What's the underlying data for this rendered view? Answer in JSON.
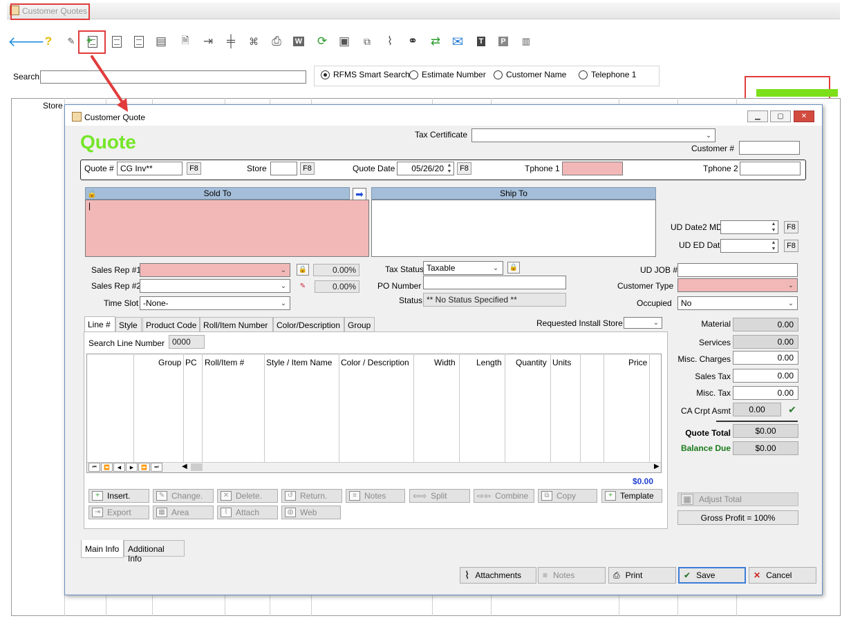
{
  "outer": {
    "title": "Customer Quotes",
    "search_label": "Search",
    "search_value": "",
    "search_options": [
      {
        "label": "RFMS Smart Search",
        "selected": true
      },
      {
        "label": "Estimate Number",
        "selected": false
      },
      {
        "label": "Customer Name",
        "selected": false
      },
      {
        "label": "Telephone 1",
        "selected": false
      }
    ],
    "grid_store_label": "Store",
    "progress": 1.0,
    "toolbar_icons": [
      "back-arrow-icon",
      "help-icon",
      "signature-icon",
      "new-quote-icon",
      "copy-document-icon",
      "edit-document-icon",
      "ledger-icon",
      "document-icon",
      "export-icon",
      "grid-icon",
      "share-icon",
      "printer-icon",
      "word-icon",
      "refresh-icon",
      "contacts-icon",
      "copy-icon",
      "paperclip-icon",
      "binoculars-icon",
      "convert-icon",
      "email-icon",
      "text-t-icon",
      "text-p-icon",
      "notebook-icon"
    ]
  },
  "dialog": {
    "title": "Customer Quote",
    "heading": "Quote",
    "tax_certificate_label": "Tax Certificate",
    "tax_certificate_value": "",
    "customer_number_label": "Customer #",
    "customer_number_value": "",
    "quote_number_label": "Quote #",
    "quote_number_value": "CG Inv**",
    "f8": "F8",
    "store_label": "Store",
    "store_value": "",
    "quote_date_label": "Quote Date",
    "quote_date_value": "05/26/20",
    "tphone1_label": "Tphone 1",
    "tphone1_value": "",
    "tphone2_label": "Tphone 2",
    "tphone2_value": "",
    "sold_to_header": "Sold To",
    "ship_to_header": "Ship To",
    "sold_to_value": "|",
    "ud_date2_label": "UD Date2 MD",
    "ud_ed_date_label": "UD ED Date",
    "sales_rep1_label": "Sales Rep #1",
    "sales_rep1_value": "",
    "sales_rep1_pct": "0.00%",
    "sales_rep2_label": "Sales Rep #2",
    "sales_rep2_value": "",
    "sales_rep2_pct": "0.00%",
    "time_slot_label": "Time Slot",
    "time_slot_value": "-None-",
    "tax_status_label": "Tax Status",
    "tax_status_value": "Taxable",
    "po_number_label": "PO Number",
    "po_number_value": "",
    "status_label": "Status",
    "status_value": "** No Status Specified **",
    "ud_job_label": "UD JOB #",
    "ud_job_value": "",
    "customer_type_label": "Customer Type",
    "customer_type_value": "",
    "occupied_label": "Occupied",
    "occupied_value": "No",
    "tabs": [
      "Line #",
      "Style",
      "Product Code",
      "Roll/Item Number",
      "Color/Description",
      "Group"
    ],
    "requested_install_store_label": "Requested Install Store",
    "search_line_label": "Search Line Number",
    "search_line_value": "0000",
    "grid_headers": [
      "Group",
      "PC",
      "Roll/Item #",
      "Style / Item Name",
      "Color / Description",
      "Width",
      "Length",
      "Quantity",
      "Units",
      "Price"
    ],
    "lines_total": "$0.00",
    "line_buttons": [
      {
        "label": "Insert.",
        "enabled": true
      },
      {
        "label": "Change.",
        "enabled": false
      },
      {
        "label": "Delete.",
        "enabled": false
      },
      {
        "label": "Return.",
        "enabled": false
      },
      {
        "label": "Notes",
        "enabled": false
      },
      {
        "label": "Split",
        "enabled": false
      },
      {
        "label": "Combine",
        "enabled": false
      },
      {
        "label": "Copy",
        "enabled": false
      },
      {
        "label": "Template",
        "enabled": true
      },
      {
        "label": "Export",
        "enabled": false
      },
      {
        "label": "Area",
        "enabled": false
      },
      {
        "label": "Attach",
        "enabled": false
      },
      {
        "label": "Web",
        "enabled": false
      }
    ],
    "bottom_tabs": [
      "Main Info",
      "Additional Info"
    ],
    "totals": {
      "material_label": "Material",
      "material": "0.00",
      "services_label": "Services",
      "services": "0.00",
      "misc_charges_label": "Misc. Charges",
      "misc_charges": "0.00",
      "sales_tax_label": "Sales Tax",
      "sales_tax": "0.00",
      "misc_tax_label": "Misc. Tax",
      "misc_tax": "0.00",
      "ca_crpt_label": "CA Crpt Asmt",
      "ca_crpt": "0.00",
      "quote_total_label": "Quote Total",
      "quote_total": "$0.00",
      "balance_due_label": "Balance Due",
      "balance_due": "$0.00"
    },
    "adjust_total_label": "Adjust Total",
    "gross_profit_label": "Gross Profit = 100%",
    "footer_buttons": {
      "attachments": "Attachments",
      "notes": "Notes",
      "print": "Print",
      "save": "Save",
      "cancel": "Cancel"
    }
  },
  "colors": {
    "quote_heading": "#74e627",
    "required_field": "#f2b8b8",
    "highlight_red": "#e23b3b",
    "section_header": "#a4bdd8",
    "balance_due": "#1a7a1a",
    "lines_total": "#1f3fd0",
    "progress": "#7cdf1a"
  }
}
